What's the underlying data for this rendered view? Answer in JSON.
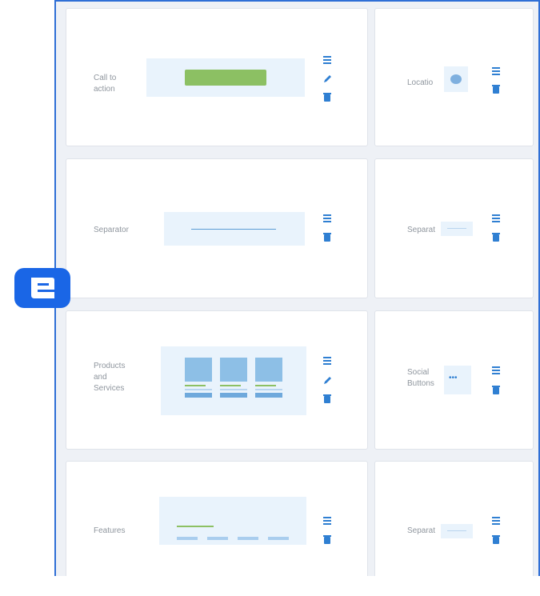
{
  "cards": {
    "cta_label_line1": "Call to",
    "cta_label_line2": "action",
    "location_label": "Locatio",
    "separator_label": "Separator",
    "separator_short_label": "Separat",
    "products_label_line1": "Products",
    "products_label_line2": "and",
    "products_label_line3": "Services",
    "social_label_line1": "Social",
    "social_label_line2": "Buttons",
    "social_preview_dots": "•••",
    "features_label": "Features",
    "separator_short_label_2": "Separat"
  },
  "icons": {
    "menu": "hamburger-menu-icon",
    "edit": "pencil-icon",
    "delete": "trash-icon"
  },
  "colors": {
    "accent_blue": "#2f7fd2",
    "cta_button_green": "#8cc063",
    "preview_bg": "#e9f3fc",
    "logo_blue": "#1a66e6"
  }
}
